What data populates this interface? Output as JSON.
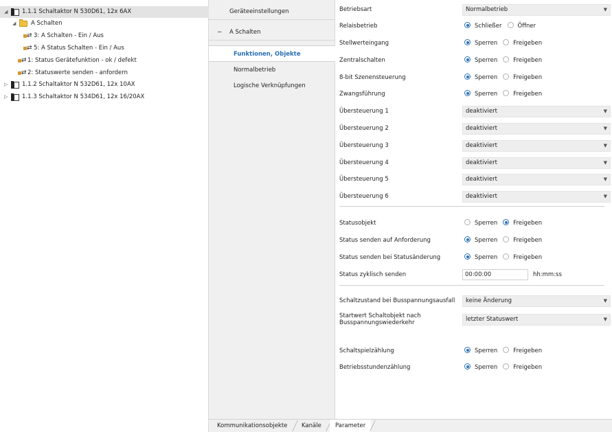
{
  "tree": {
    "items": [
      {
        "label": "1.1.1 Schaltaktor N 530D61, 12x 6AX",
        "twisty": "◢",
        "icon": "device-icon"
      },
      {
        "label": "A   Schalten",
        "twisty": "◢",
        "icon": "folder-icon"
      },
      {
        "label": "3: A    Schalten - Ein / Aus",
        "icon": "group-object-icon"
      },
      {
        "label": "5: A    Status Schalten - Ein / Aus",
        "icon": "group-object-icon"
      },
      {
        "label": "1: Status Gerätefunktion - ok / defekt",
        "icon": "group-object-icon"
      },
      {
        "label": "2: Statuswerte senden - anfordern",
        "icon": "group-object-icon"
      },
      {
        "label": "1.1.2 Schaltaktor N 532D61, 12x 10AX",
        "twisty": "▷",
        "icon": "device-icon"
      },
      {
        "label": "1.1.3 Schaltaktor N 534D61, 12x 16/20AX",
        "twisty": "▷",
        "icon": "device-icon"
      }
    ]
  },
  "nav": {
    "device_settings": "Geräteeinstellungen",
    "group_minus": "−",
    "group_label": "A   Schalten",
    "functions": "Funktionen, Objekte",
    "normal": "Normalbetrieb",
    "logic": "Logische Verknüpfungen"
  },
  "params": {
    "betriebsart": {
      "label": "Betriebsart",
      "value": "Normalbetrieb"
    },
    "relaisbetrieb": {
      "label": "Relaisbetrieb",
      "opt1": "Schließer",
      "opt2": "Öffner",
      "selected": 1
    },
    "stellwerteingang": {
      "label": "Stellwerteingang",
      "opt1": "Sperren",
      "opt2": "Freigeben",
      "selected": 1
    },
    "zentralschalten": {
      "label": "Zentralschalten",
      "opt1": "Sperren",
      "opt2": "Freigeben",
      "selected": 1
    },
    "szenen": {
      "label": "8-bit Szenensteuerung",
      "opt1": "Sperren",
      "opt2": "Freigeben",
      "selected": 1
    },
    "zwangsfuehrung": {
      "label": "Zwangsführung",
      "opt1": "Sperren",
      "opt2": "Freigeben",
      "selected": 1
    },
    "ueberst1": {
      "label": "Übersteuerung 1",
      "value": "deaktiviert"
    },
    "ueberst2": {
      "label": "Übersteuerung 2",
      "value": "deaktiviert"
    },
    "ueberst3": {
      "label": "Übersteuerung 3",
      "value": "deaktiviert"
    },
    "ueberst4": {
      "label": "Übersteuerung 4",
      "value": "deaktiviert"
    },
    "ueberst5": {
      "label": "Übersteuerung 5",
      "value": "deaktiviert"
    },
    "ueberst6": {
      "label": "Übersteuerung 6",
      "value": "deaktiviert"
    },
    "statusobjekt": {
      "label": "Statusobjekt",
      "opt1": "Sperren",
      "opt2": "Freigeben",
      "selected": 2
    },
    "status_anforderung": {
      "label": "Status senden auf Anforderung",
      "opt1": "Sperren",
      "opt2": "Freigeben",
      "selected": 1
    },
    "status_aenderung": {
      "label": "Status senden bei Statusänderung",
      "opt1": "Sperren",
      "opt2": "Freigeben",
      "selected": 1
    },
    "status_zyklisch": {
      "label": "Status zyklisch senden",
      "value": "00:00:00",
      "unit": "hh:mm:ss"
    },
    "busausfall": {
      "label": "Schaltzustand bei Busspannungsausfall",
      "value": "keine Änderung"
    },
    "startwert": {
      "label_line1": "Startwert Schaltobjekt nach",
      "label_line2": "Busspannungswiederkehr",
      "value": "letzter Statuswert"
    },
    "schaltspiel": {
      "label": "Schaltspielzählung",
      "opt1": "Sperren",
      "opt2": "Freigeben",
      "selected": 1
    },
    "betriebsstunden": {
      "label": "Betriebsstundenzählung",
      "opt1": "Sperren",
      "opt2": "Freigeben",
      "selected": 1
    }
  },
  "tabs": {
    "kommunikation": "Kommunikationsobjekte",
    "kanaele": "Kanäle",
    "parameter": "Parameter"
  },
  "dropdown_caret": "▼",
  "colors": {
    "accent": "#2a6fb5",
    "selection": "#e3e3e3",
    "nav_bg": "#f0f0f0"
  }
}
